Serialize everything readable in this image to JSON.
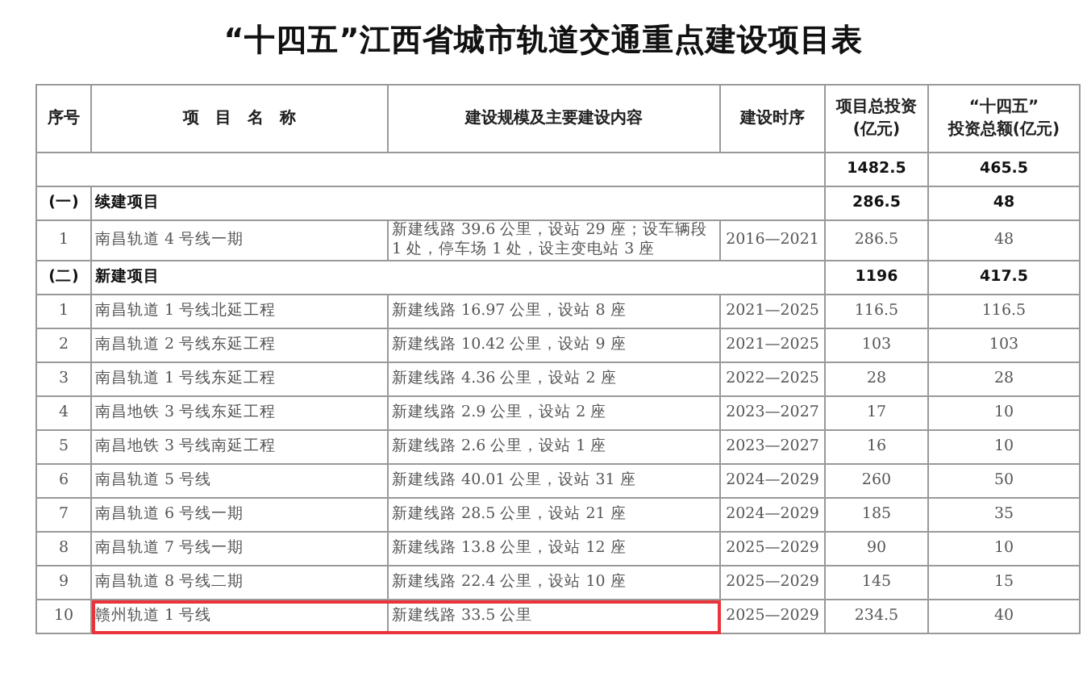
{
  "title": "“十四五”江西省城市轨道交通重点建设项目表",
  "columns": [
    {
      "label": "序号"
    },
    {
      "label": "项　目　名　称"
    },
    {
      "label": "建设规模及主要建设内容"
    },
    {
      "label": "建设时序"
    },
    {
      "label": "项目总投资\n(亿元)"
    },
    {
      "label": "“十四五”\n投资总额(亿元)"
    }
  ],
  "rows": [
    {
      "kind": "total",
      "investment": "1482.5",
      "five_year": "465.5"
    },
    {
      "kind": "section",
      "number": "(一)",
      "name": "续建项目",
      "investment": "286.5",
      "five_year": "48"
    },
    {
      "kind": "item",
      "number": "1",
      "name": "南昌轨道 4 号线一期",
      "content": "新建线路 39.6 公里，设站 29 座；设车辆段 1 处，停车场 1 处，设主变电站 3 座",
      "period": "2016—2021",
      "investment": "286.5",
      "five_year": "48",
      "highlighted": false
    },
    {
      "kind": "section",
      "number": "(二)",
      "name": "新建项目",
      "investment": "1196",
      "five_year": "417.5"
    },
    {
      "kind": "item",
      "number": "1",
      "name": "南昌轨道 1 号线北延工程",
      "content": "新建线路 16.97 公里，设站 8 座",
      "period": "2021—2025",
      "investment": "116.5",
      "five_year": "116.5",
      "highlighted": false
    },
    {
      "kind": "item",
      "number": "2",
      "name": "南昌轨道 2 号线东延工程",
      "content": "新建线路 10.42 公里，设站 9 座",
      "period": "2021—2025",
      "investment": "103",
      "five_year": "103",
      "highlighted": false
    },
    {
      "kind": "item",
      "number": "3",
      "name": "南昌轨道 1 号线东延工程",
      "content": "新建线路 4.36 公里，设站 2 座",
      "period": "2022—2025",
      "investment": "28",
      "five_year": "28",
      "highlighted": false
    },
    {
      "kind": "item",
      "number": "4",
      "name": "南昌地铁 3 号线东延工程",
      "content": "新建线路 2.9 公里，设站 2 座",
      "period": "2023—2027",
      "investment": "17",
      "five_year": "10",
      "highlighted": false
    },
    {
      "kind": "item",
      "number": "5",
      "name": "南昌地铁 3 号线南延工程",
      "content": "新建线路 2.6 公里，设站 1 座",
      "period": "2023—2027",
      "investment": "16",
      "five_year": "10",
      "highlighted": false
    },
    {
      "kind": "item",
      "number": "6",
      "name": "南昌轨道 5 号线",
      "content": "新建线路 40.01 公里，设站 31 座",
      "period": "2024—2029",
      "investment": "260",
      "five_year": "50",
      "highlighted": false
    },
    {
      "kind": "item",
      "number": "7",
      "name": "南昌轨道 6 号线一期",
      "content": "新建线路 28.5 公里，设站 21 座",
      "period": "2024—2029",
      "investment": "185",
      "five_year": "35",
      "highlighted": false
    },
    {
      "kind": "item",
      "number": "8",
      "name": "南昌轨道 7 号线一期",
      "content": "新建线路 13.8 公里，设站 12 座",
      "period": "2025—2029",
      "investment": "90",
      "five_year": "10",
      "highlighted": false
    },
    {
      "kind": "item",
      "number": "9",
      "name": "南昌轨道 8 号线二期",
      "content": "新建线路 22.4 公里，设站 10 座",
      "period": "2025—2029",
      "investment": "145",
      "five_year": "15",
      "highlighted": false
    },
    {
      "kind": "item",
      "number": "10",
      "name": "赣州轨道 1 号线",
      "content": "新建线路 33.5 公里",
      "period": "2025—2029",
      "investment": "234.5",
      "five_year": "40",
      "highlighted": true
    }
  ]
}
